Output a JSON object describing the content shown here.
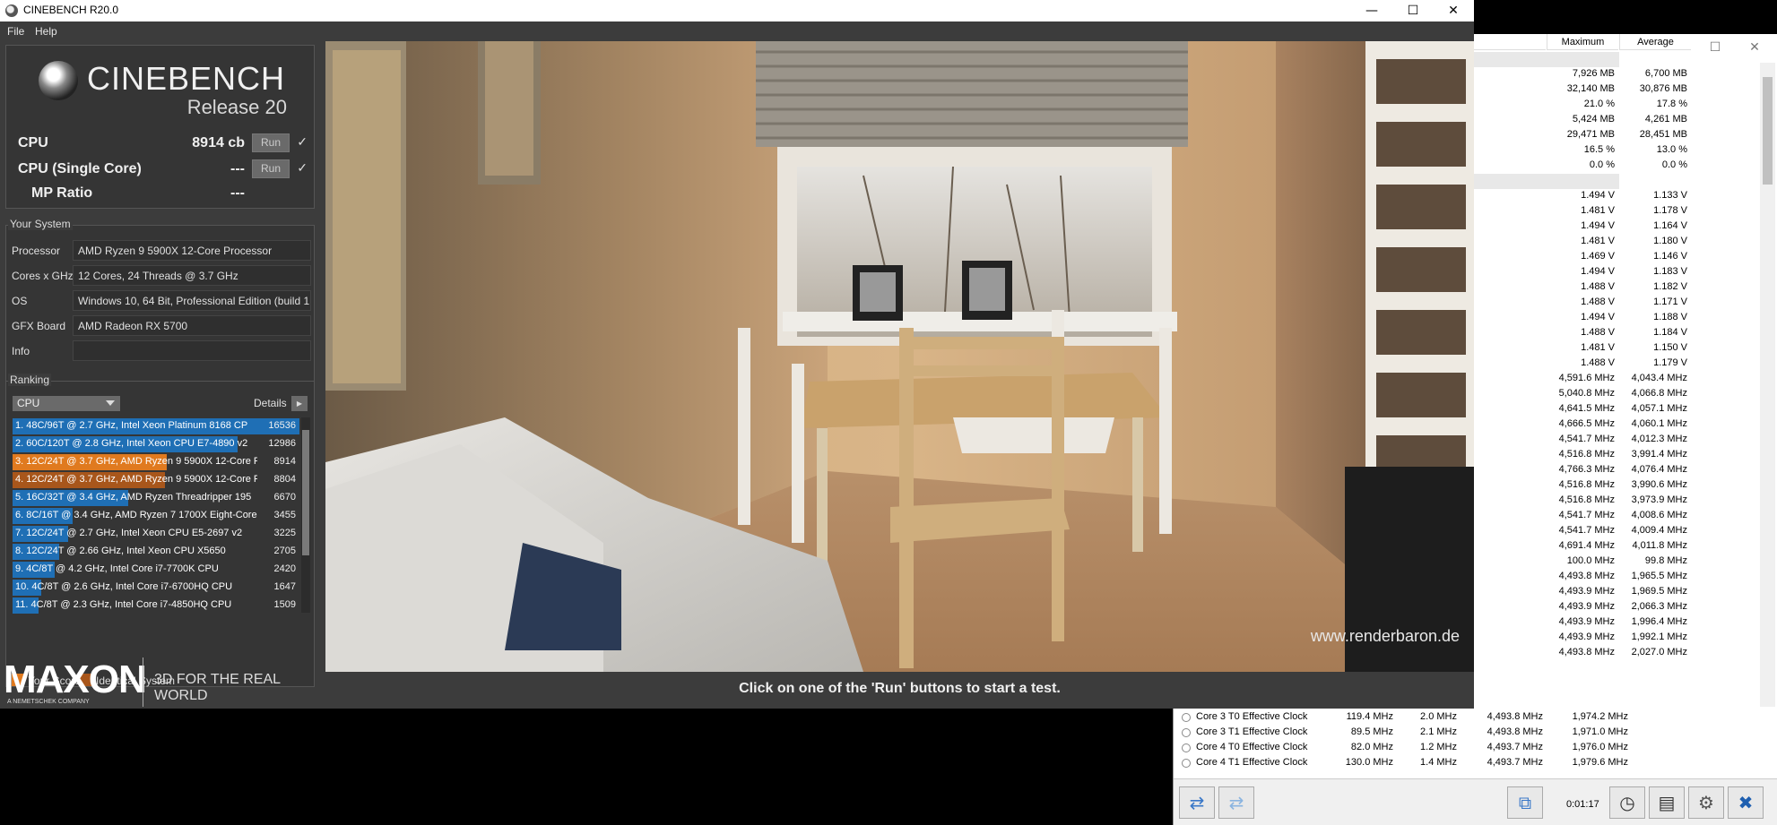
{
  "cinebench": {
    "title": "CINEBENCH R20.0",
    "menu": [
      "File",
      "Help"
    ],
    "logo_title": "CINEBENCH",
    "logo_release": "Release 20",
    "cpu_label": "CPU",
    "cpu_score": "8914 cb",
    "single_label": "CPU (Single Core)",
    "single_score": "---",
    "mp_label": "MP Ratio",
    "mp_score": "---",
    "run_label": "Run",
    "check": "✓",
    "your_system": "Your System",
    "system": [
      {
        "label": "Processor",
        "value": "AMD Ryzen 9 5900X 12-Core Processor"
      },
      {
        "label": "Cores x GHz",
        "value": "12 Cores, 24 Threads @ 3.7 GHz"
      },
      {
        "label": "OS",
        "value": "Windows 10, 64 Bit, Professional Edition (build 1!"
      },
      {
        "label": "GFX Board",
        "value": "AMD Radeon RX 5700"
      },
      {
        "label": "Info",
        "value": ""
      }
    ],
    "ranking_title": "Ranking",
    "ranking_select": "CPU",
    "details_label": "Details",
    "ranking": [
      {
        "text": "1. 48C/96T @ 2.7 GHz, Intel Xeon Platinum 8168 CP",
        "score": "16536",
        "fill": 1.0,
        "kind": "other"
      },
      {
        "text": "2. 60C/120T @ 2.8 GHz, Intel Xeon CPU E7-4890 v2",
        "score": "12986",
        "fill": 0.785,
        "kind": "other"
      },
      {
        "text": "3. 12C/24T @ 3.7 GHz, AMD Ryzen 9 5900X 12-Core F",
        "score": "8914",
        "fill": 0.539,
        "kind": "yours"
      },
      {
        "text": "4. 12C/24T @ 3.7 GHz, AMD Ryzen 9 5900X 12-Core F",
        "score": "8804",
        "fill": 0.532,
        "kind": "identical"
      },
      {
        "text": "5. 16C/32T @ 3.4 GHz, AMD Ryzen Threadripper 195",
        "score": "6670",
        "fill": 0.403,
        "kind": "other"
      },
      {
        "text": "6. 8C/16T @ 3.4 GHz, AMD Ryzen 7 1700X Eight-Core",
        "score": "3455",
        "fill": 0.209,
        "kind": "other"
      },
      {
        "text": "7. 12C/24T @ 2.7 GHz, Intel Xeon CPU E5-2697 v2",
        "score": "3225",
        "fill": 0.195,
        "kind": "other"
      },
      {
        "text": "8. 12C/24T @ 2.66 GHz, Intel Xeon CPU X5650",
        "score": "2705",
        "fill": 0.164,
        "kind": "other"
      },
      {
        "text": "9. 4C/8T @ 4.2 GHz, Intel Core i7-7700K CPU",
        "score": "2420",
        "fill": 0.146,
        "kind": "other"
      },
      {
        "text": "10. 4C/8T @ 2.6 GHz, Intel Core i7-6700HQ CPU",
        "score": "1647",
        "fill": 0.1,
        "kind": "other"
      },
      {
        "text": "11. 4C/8T @ 2.3 GHz, Intel Core i7-4850HQ CPU",
        "score": "1509",
        "fill": 0.091,
        "kind": "other"
      }
    ],
    "legend_yours": "Your Score",
    "legend_identical": "Identical System",
    "maxon": "MAXON",
    "maxon_sub": "A NEMETSCHEK COMPANY",
    "maxon_tag": "3D FOR THE REAL WORLD",
    "watermark": "www.renderbaron.de",
    "status": "Click on one of the 'Run' buttons to start a test.",
    "colors": {
      "bar": "#1f6fb5",
      "yours": "#e07a1f",
      "identical": "#a8561b"
    }
  },
  "hwinfo": {
    "col_max": "Maximum",
    "col_avg": "Average",
    "rows": [
      {
        "max": "",
        "avg": "",
        "sep": true
      },
      {
        "max": "7,926 MB",
        "avg": "6,700 MB"
      },
      {
        "max": "32,140 MB",
        "avg": "30,876 MB"
      },
      {
        "max": "21.0 %",
        "avg": "17.8 %"
      },
      {
        "max": "5,424 MB",
        "avg": "4,261 MB"
      },
      {
        "max": "29,471 MB",
        "avg": "28,451 MB"
      },
      {
        "max": "16.5 %",
        "avg": "13.0 %"
      },
      {
        "max": "0.0 %",
        "avg": "0.0 %"
      },
      {
        "max": "",
        "avg": "",
        "sep": true
      },
      {
        "max": "1.494 V",
        "avg": "1.133 V"
      },
      {
        "max": "1.481 V",
        "avg": "1.178 V"
      },
      {
        "max": "1.494 V",
        "avg": "1.164 V"
      },
      {
        "max": "1.481 V",
        "avg": "1.180 V"
      },
      {
        "max": "1.469 V",
        "avg": "1.146 V"
      },
      {
        "max": "1.494 V",
        "avg": "1.183 V"
      },
      {
        "max": "1.488 V",
        "avg": "1.182 V"
      },
      {
        "max": "1.488 V",
        "avg": "1.171 V"
      },
      {
        "max": "1.494 V",
        "avg": "1.188 V"
      },
      {
        "max": "1.488 V",
        "avg": "1.184 V"
      },
      {
        "max": "1.481 V",
        "avg": "1.150 V"
      },
      {
        "max": "1.488 V",
        "avg": "1.179 V"
      },
      {
        "max": "4,591.6 MHz",
        "avg": "4,043.4 MHz"
      },
      {
        "max": "5,040.8 MHz",
        "avg": "4,066.8 MHz"
      },
      {
        "max": "4,641.5 MHz",
        "avg": "4,057.1 MHz"
      },
      {
        "max": "4,666.5 MHz",
        "avg": "4,060.1 MHz"
      },
      {
        "max": "4,541.7 MHz",
        "avg": "4,012.3 MHz"
      },
      {
        "max": "4,516.8 MHz",
        "avg": "3,991.4 MHz"
      },
      {
        "max": "4,766.3 MHz",
        "avg": "4,076.4 MHz"
      },
      {
        "max": "4,516.8 MHz",
        "avg": "3,990.6 MHz"
      },
      {
        "max": "4,516.8 MHz",
        "avg": "3,973.9 MHz"
      },
      {
        "max": "4,541.7 MHz",
        "avg": "4,008.6 MHz"
      },
      {
        "max": "4,541.7 MHz",
        "avg": "4,009.4 MHz"
      },
      {
        "max": "4,691.4 MHz",
        "avg": "4,011.8 MHz"
      },
      {
        "max": "100.0 MHz",
        "avg": "99.8 MHz"
      },
      {
        "max": "4,493.8 MHz",
        "avg": "1,965.5 MHz"
      },
      {
        "max": "4,493.9 MHz",
        "avg": "1,969.5 MHz"
      },
      {
        "max": "4,493.9 MHz",
        "avg": "2,066.3 MHz"
      },
      {
        "max": "4,493.9 MHz",
        "avg": "1,996.4 MHz"
      },
      {
        "max": "4,493.9 MHz",
        "avg": "1,992.1 MHz"
      },
      {
        "max": "4,493.8 MHz",
        "avg": "2,027.0 MHz"
      }
    ],
    "bottom_rows": [
      {
        "name": "Core 3 T0 Effective Clock",
        "cur": "119.4 MHz",
        "min": "2.0 MHz",
        "max": "4,493.8 MHz",
        "avg": "1,974.2 MHz"
      },
      {
        "name": "Core 3 T1 Effective Clock",
        "cur": "89.5 MHz",
        "min": "2.1 MHz",
        "max": "4,493.8 MHz",
        "avg": "1,971.0 MHz"
      },
      {
        "name": "Core 4 T0 Effective Clock",
        "cur": "82.0 MHz",
        "min": "1.2 MHz",
        "max": "4,493.7 MHz",
        "avg": "1,976.0 MHz"
      },
      {
        "name": "Core 4 T1 Effective Clock",
        "cur": "130.0 MHz",
        "min": "1.4 MHz",
        "max": "4,493.7 MHz",
        "avg": "1,979.6 MHz"
      }
    ],
    "timer": "0:01:17"
  }
}
